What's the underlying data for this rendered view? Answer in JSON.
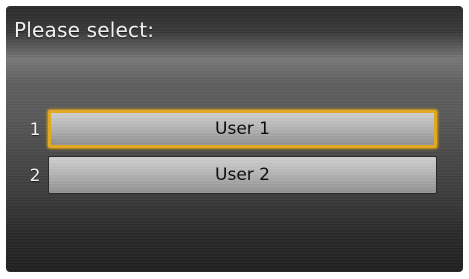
{
  "prompt": "Please select:",
  "options": [
    {
      "number": "1",
      "label": "User 1",
      "selected": true
    },
    {
      "number": "2",
      "label": "User 2",
      "selected": false
    }
  ],
  "colors": {
    "highlight": "#e0a825",
    "text": "#f2f2f2",
    "button_text": "#0d0d0d"
  }
}
